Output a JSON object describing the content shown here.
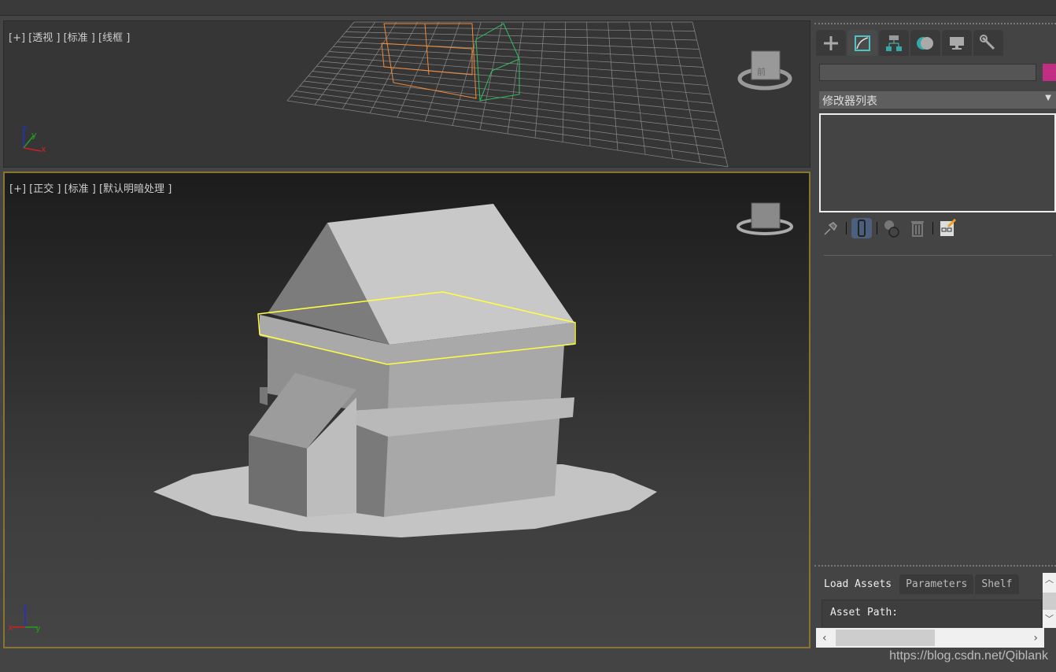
{
  "viewports": [
    {
      "label": "[+] [透视 ] [标准 ] [线框 ]",
      "view": "perspective"
    },
    {
      "label": "[+] [正交 ] [标准 ] [默认明暗处理 ]",
      "view": "orthographic",
      "active": true
    }
  ],
  "axis_labels": {
    "x": "x",
    "y": "y",
    "z": "z"
  },
  "viewcube_label": "前",
  "command_panel": {
    "tabs": [
      {
        "icon": "plus-icon",
        "name": "create"
      },
      {
        "icon": "modify-icon",
        "name": "modify",
        "active": true
      },
      {
        "icon": "hierarchy-icon",
        "name": "hierarchy"
      },
      {
        "icon": "motion-icon",
        "name": "motion"
      },
      {
        "icon": "display-icon",
        "name": "display"
      },
      {
        "icon": "wrench-icon",
        "name": "utilities"
      }
    ],
    "object_name": "",
    "object_color": "#c12e83",
    "modifier_list": "修改器列表",
    "stack_tools": [
      "pin-icon",
      "show-end-result-icon",
      "make-unique-icon",
      "remove-modifier-icon",
      "configure-sets-icon"
    ]
  },
  "bottom_panel": {
    "tabs": [
      "Load Assets",
      "Parameters",
      "Shelf"
    ],
    "active_tab": "Load Assets",
    "asset_path_label": "Asset Path:"
  },
  "watermark": "https://blog.csdn.net/Qiblank",
  "colors": {
    "selection": "#ffff40",
    "active_border": "#8a7432",
    "accent": "#4fc3c3"
  }
}
